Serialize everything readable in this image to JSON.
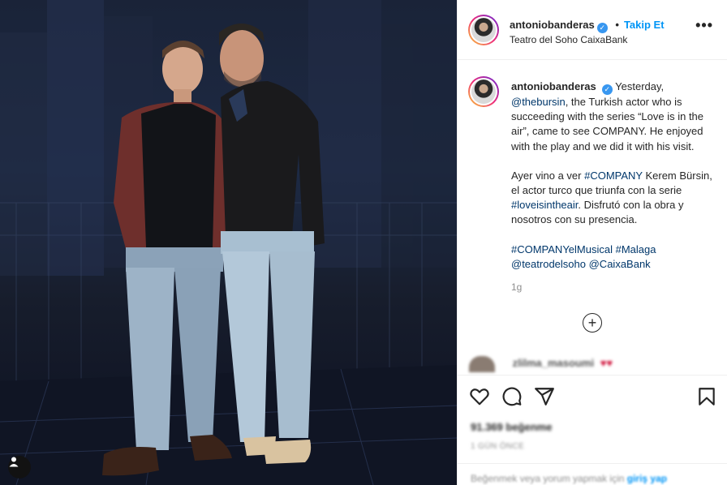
{
  "post": {
    "username": "antoniobanderas",
    "follow_label": "Takip Et",
    "separator": "•",
    "location": "Teatro del Soho CaixaBank",
    "more_label": "•••",
    "verified_mark": "✓"
  },
  "caption": {
    "paragraph1": {
      "t1": "Yesterday, ",
      "mention1": "@thebursin",
      "t2": ", the Turkish actor who is succeeding with the series “Love is in the air”, came to see COMPANY. He enjoyed with the play and we did it with his visit."
    },
    "paragraph2": {
      "t1": "Ayer vino a ver ",
      "tag1": "#COMPANY",
      "t2": " Kerem Bürsin, el actor turco que triunfa con la serie ",
      "tag2": "#loveisintheair",
      "t3": ". Disfrutó con la obra y nosotros con su presencia."
    },
    "paragraph3": {
      "tag1": "#COMPANYelMusical",
      "tag2": "#Malaga",
      "mention1": "@teatrodelsoho",
      "mention2": "@CaixaBank"
    },
    "time": "1g",
    "load_more": "+"
  },
  "comment": {
    "username": "zlilma_masoumi",
    "hearts": "♥♥"
  },
  "actions": {
    "icons": [
      "heart-icon",
      "comment-icon",
      "share-icon",
      "bookmark-icon"
    ],
    "likes": "91.369 beğenme",
    "ago": "1 GÜN ÖNCE"
  },
  "login": {
    "text": "Beğenmek veya yorum yapmak için ",
    "link": "giriş yap"
  },
  "colors": {
    "accent": "#0095f6",
    "hashtag": "#00376b",
    "muted": "#8e8e8e",
    "verified": "#3897f0"
  }
}
